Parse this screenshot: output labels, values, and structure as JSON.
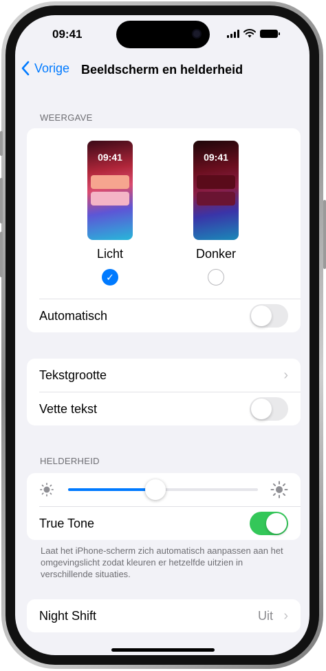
{
  "status": {
    "time": "09:41"
  },
  "nav": {
    "back_label": "Vorige",
    "title": "Beeldscherm en helderheid"
  },
  "appearance": {
    "header": "WEERGAVE",
    "light": {
      "label": "Licht",
      "preview_time": "09:41",
      "selected": true
    },
    "dark": {
      "label": "Donker",
      "preview_time": "09:41",
      "selected": false
    },
    "automatic_label": "Automatisch",
    "automatic_on": false
  },
  "text": {
    "text_size_label": "Tekstgrootte",
    "bold_label": "Vette tekst",
    "bold_on": false
  },
  "brightness": {
    "header": "HELDERHEID",
    "level": 0.46,
    "true_tone_label": "True Tone",
    "true_tone_on": true,
    "footnote": "Laat het iPhone-scherm zich automatisch aanpassen aan het omgevingslicht zodat kleuren er hetzelfde uitzien in verschillende situaties."
  },
  "night_shift": {
    "label": "Night Shift",
    "value": "Uit"
  },
  "colors": {
    "accent": "#007aff",
    "toggle_on": "#34c759",
    "background": "#f2f2f7"
  }
}
